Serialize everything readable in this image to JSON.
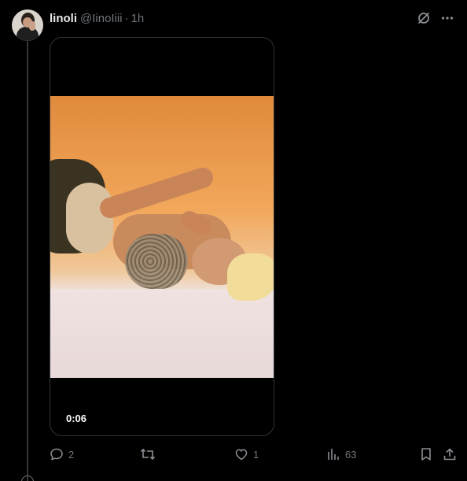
{
  "post": {
    "display_name": "linoli",
    "handle": "@IinoIiii",
    "separator": "·",
    "time": "1h",
    "video": {
      "duration": "0:06"
    },
    "actions": {
      "replies": "2",
      "reposts": "",
      "likes": "1",
      "views": "63"
    }
  },
  "icons": {
    "grok": "grok-slash-icon",
    "more": "more-dots-icon",
    "reply": "reply-icon",
    "repost": "repost-icon",
    "like": "heart-icon",
    "views": "views-bar-icon",
    "bookmark": "bookmark-icon",
    "share": "share-icon"
  },
  "colors": {
    "background": "#000000",
    "text": "#e7e9ea",
    "muted": "#71767b",
    "border": "#2f3336"
  }
}
